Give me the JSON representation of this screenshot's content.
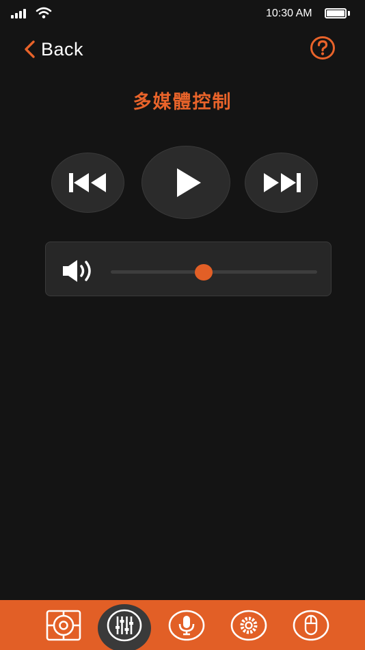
{
  "status_bar": {
    "time": "10:30 AM",
    "battery_level": 1.0,
    "icons": [
      "signal-icon",
      "wifi-icon",
      "battery-icon"
    ]
  },
  "nav": {
    "back_label": "Back",
    "back_icon": "chevron-left-icon",
    "help_icon": "question-circle-icon"
  },
  "title": "多媒體控制",
  "media_controls": {
    "buttons": [
      "previous-track-icon",
      "play-icon",
      "next-track-icon"
    ]
  },
  "volume": {
    "icon": "speaker-icon",
    "level": 0.45
  },
  "tab_bar": {
    "active_index": 1,
    "tabs": [
      {
        "icon": "touchpad-target-icon"
      },
      {
        "icon": "equalizer-sliders-icon"
      },
      {
        "icon": "microphone-icon"
      },
      {
        "icon": "settings-gear-icon"
      },
      {
        "icon": "mouse-icon"
      }
    ]
  },
  "colors": {
    "accent": "#e25f26",
    "title": "#e8632a",
    "background": "#141414",
    "button_bg": "#2b2b2b"
  }
}
